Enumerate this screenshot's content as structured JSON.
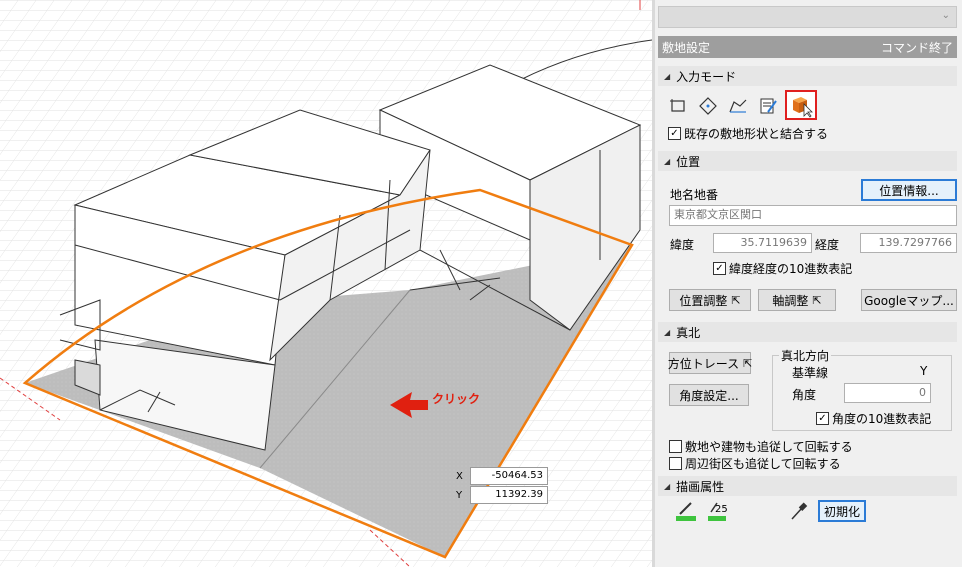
{
  "viewport": {
    "click_label": "クリック",
    "coords": [
      {
        "axis": "X",
        "value": "-50464.53"
      },
      {
        "axis": "Y",
        "value": "11392.39"
      }
    ],
    "colors": {
      "site_outline": "#f07d10",
      "site_fill": "#b9b9b9",
      "arrow": "#e02010"
    }
  },
  "panel": {
    "top_combo_value": "",
    "title": "敷地設定",
    "end_command": "コマンド終了",
    "input_mode": {
      "heading": "入力モード",
      "modes": [
        "rectangle-mode-icon",
        "polygon-mode-icon",
        "polyline-mode-icon",
        "edit-mode-icon",
        "select-building-mode-icon"
      ],
      "combine_checkbox": {
        "label": "既存の敷地形状と結合する",
        "checked": true
      }
    },
    "position": {
      "heading": "位置",
      "address_label": "地名地番",
      "location_info_button": "位置情報...",
      "address_value": "東京都文京区関口",
      "latitude_label": "緯度",
      "latitude_value": "35.7119639",
      "longitude_label": "経度",
      "longitude_value": "139.7297766",
      "decimal_checkbox": {
        "label": "緯度経度の10進数表記",
        "checked": true
      },
      "adjust_position_button": "位置調整",
      "adjust_axis_button": "軸調整",
      "google_map_button": "Googleマップ..."
    },
    "true_north": {
      "heading": "真北",
      "trace_button": "方位トレース",
      "angle_settings_button": "角度設定...",
      "direction_group_title": "真北方向",
      "baseline_label": "基準線",
      "baseline_value": "Y",
      "angle_label": "角度",
      "angle_value": "0",
      "angle_decimal_checkbox": {
        "label": "角度の10進数表記",
        "checked": true
      },
      "rotate_site_checkbox": {
        "label": "敷地や建物も追従して回転する",
        "checked": false
      },
      "rotate_block_checkbox": {
        "label": "周辺街区も追従して回転する",
        "checked": false
      }
    },
    "draw_attributes": {
      "heading": "描画属性",
      "line_width_value": "25",
      "reset_button": "初期化",
      "accent_green": "#3ec43e"
    }
  }
}
